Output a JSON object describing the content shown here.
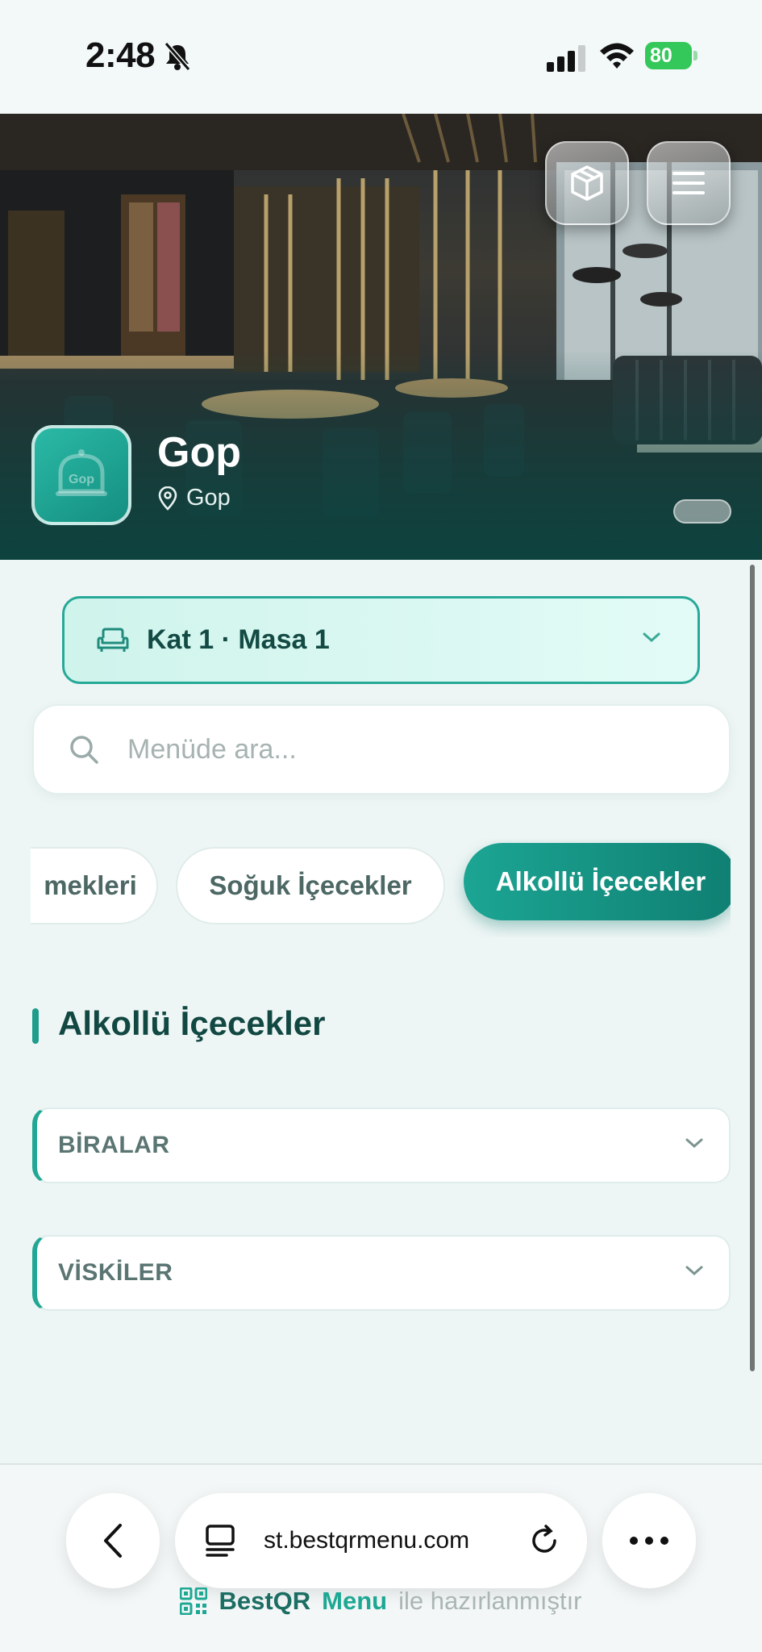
{
  "status_bar": {
    "time": "2:48",
    "battery": "80"
  },
  "header": {
    "restaurant_name": "Gop",
    "location": "Gop",
    "logo_text": "Gop"
  },
  "table_selector": {
    "label": "Kat 1 · Masa 1"
  },
  "search": {
    "placeholder": "Menüde ara..."
  },
  "categories": [
    {
      "label": "mekleri",
      "active": false
    },
    {
      "label": "Soğuk İçecekler",
      "active": false
    },
    {
      "label": "Alkollü İçecekler",
      "active": true
    }
  ],
  "section": {
    "title": "Alkollü İçecekler",
    "groups": [
      {
        "label": "BİRALAR"
      },
      {
        "label": "VİSKİLER"
      }
    ]
  },
  "browser": {
    "url": "st.bestqrmenu.com"
  },
  "footer": {
    "brand_part1": "BestQR",
    "brand_part2": "Menu",
    "tail": "ile hazırlanmıştır"
  },
  "colors": {
    "accent": "#1ea894",
    "accent_dark": "#0f7f72",
    "title": "#124842",
    "background": "#eef6f5"
  }
}
